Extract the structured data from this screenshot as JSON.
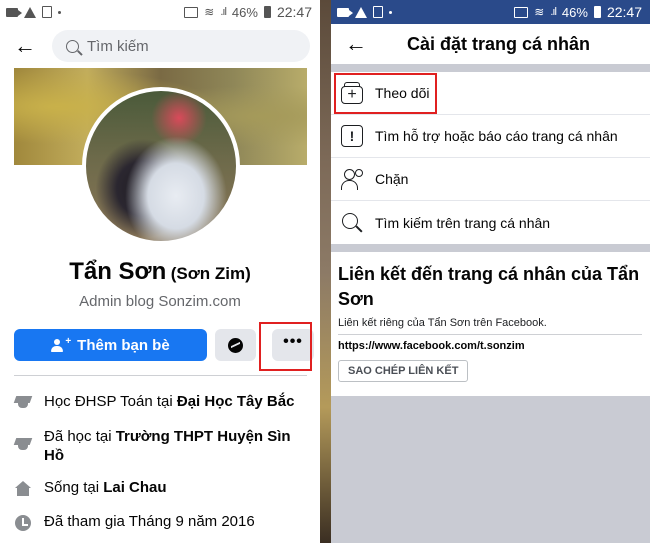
{
  "status_bar": {
    "left_icons": [
      "video-camera-icon",
      "warning-icon",
      "screenshot-icon",
      "dot-icon"
    ],
    "right_icons": [
      "cast-icon",
      "wifi-icon",
      "signal-icon"
    ],
    "battery": "46%",
    "time": "22:47"
  },
  "profile_screen": {
    "back_icon": "arrow-left-icon",
    "search": {
      "placeholder": "Tìm kiếm"
    },
    "name": "Tẩn Sơn",
    "alt_name": "(Sơn Zim)",
    "bio": "Admin blog Sonzim.com",
    "actions": {
      "add_friend": "Thêm bạn bè",
      "messenger_icon": "messenger-icon",
      "more_icon": "more-dots-icon",
      "more_label": "•••"
    },
    "details": [
      {
        "icon": "graduation-cap-icon",
        "prefix": "Học ĐHSP Toán tại ",
        "bold": "Đại Học Tây Bắc"
      },
      {
        "icon": "graduation-cap-icon",
        "prefix": "Đã học tại ",
        "bold": "Trường THPT Huyện Sìn Hồ"
      },
      {
        "icon": "home-icon",
        "prefix": "Sống tại ",
        "bold": "Lai Chau"
      },
      {
        "icon": "clock-icon",
        "prefix": "Đã tham gia Tháng 9 năm 2016",
        "bold": ""
      }
    ]
  },
  "settings_screen": {
    "title": "Cài đặt trang cá nhân",
    "menu": [
      {
        "icon": "follow-icon",
        "label": "Theo dõi"
      },
      {
        "icon": "report-icon",
        "label": "Tìm hỗ trợ hoặc báo cáo trang cá nhân"
      },
      {
        "icon": "block-user-icon",
        "label": "Chặn"
      },
      {
        "icon": "search-icon",
        "label": "Tìm kiếm trên trang cá nhân"
      }
    ],
    "link_section": {
      "heading": "Liên kết đến trang cá nhân của Tẩn Sơn",
      "subtitle": "Liên kết riêng của Tẩn Sơn trên Facebook.",
      "url": "https://www.facebook.com/t.sonzim",
      "copy_button": "SAO CHÉP LIÊN KẾT"
    }
  },
  "colors": {
    "brand_blue": "#1877f2",
    "highlight_red": "#e02020",
    "status_bar_right": "#2a4a8a"
  }
}
